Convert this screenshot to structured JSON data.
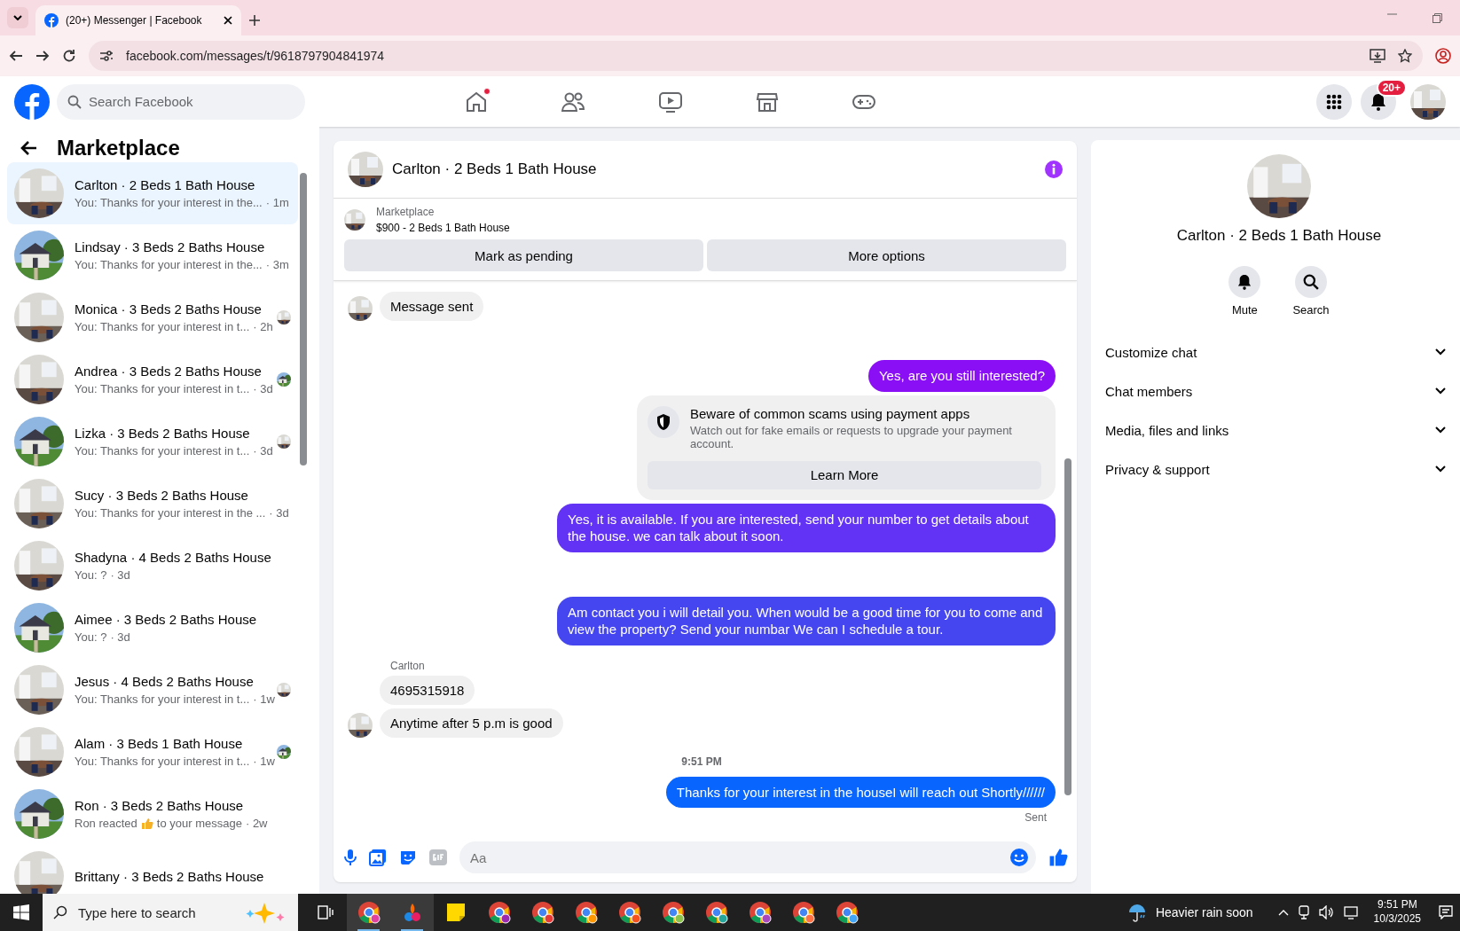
{
  "browser": {
    "tab_title": "(20+) Messenger | Facebook",
    "url": "facebook.com/messages/t/9618797904841974"
  },
  "topbar": {
    "search_placeholder": "Search Facebook",
    "notification_count": "20+",
    "home_dot": true
  },
  "sidebar": {
    "title": "Marketplace",
    "items": [
      {
        "name": "Carlton · 2 Beds 1 Bath House",
        "preview": "You: Thanks for your interest in the...",
        "time": " · 1m",
        "selected": true,
        "reader": false
      },
      {
        "name": "Lindsay · 3 Beds 2 Baths House",
        "preview": "You: Thanks for your interest in the...",
        "time": " · 3m",
        "selected": false,
        "reader": false
      },
      {
        "name": "Monica · 3 Beds 2 Baths House",
        "preview": "You: Thanks for your interest in t...",
        "time": " · 2h",
        "selected": false,
        "reader": true
      },
      {
        "name": "Andrea · 3 Beds 2 Baths House",
        "preview": "You: Thanks for your interest in t...",
        "time": " · 3d",
        "selected": false,
        "reader": true
      },
      {
        "name": "Lizka · 3 Beds 2 Baths House",
        "preview": "You: Thanks for your interest in t...",
        "time": " · 3d",
        "selected": false,
        "reader": true
      },
      {
        "name": "Sucy · 3 Beds 2 Baths House",
        "preview": "You: Thanks for your interest in the ...",
        "time": " · 3d",
        "selected": false,
        "reader": false
      },
      {
        "name": "Shadyna · 4 Beds 2 Baths House",
        "preview": "You: ?",
        "time": " · 3d",
        "selected": false,
        "reader": false
      },
      {
        "name": "Aimee · 3 Beds 2 Baths House",
        "preview": "You: ?",
        "time": " · 3d",
        "selected": false,
        "reader": false
      },
      {
        "name": "Jesus · 4 Beds 2 Baths House",
        "preview": "You: Thanks for your interest in t...",
        "time": " · 1w",
        "selected": false,
        "reader": true
      },
      {
        "name": "Alam · 3 Beds 1 Bath House",
        "preview": "You: Thanks for your interest in t...",
        "time": " · 1w",
        "selected": false,
        "reader": true
      },
      {
        "name": "Ron · 3 Beds 2 Baths House",
        "preview": "Ron reacted",
        "reaction": true,
        "preview_after": "to your message",
        "time": " · 2w",
        "selected": false,
        "reader": false
      },
      {
        "name": "Brittany · 3 Beds 2 Baths House",
        "selected": false,
        "reader": false
      }
    ]
  },
  "chat": {
    "title": "Carlton · 2 Beds 1 Bath House",
    "listing": {
      "label": "Marketplace",
      "price_title": "$900 - 2 Beds 1 Bath House"
    },
    "actions": [
      "Mark as pending",
      "More options"
    ],
    "messages": [
      {
        "kind": "incoming",
        "text": "Message sent",
        "avatar": true
      },
      {
        "kind": "outgoing",
        "text": "Yes, are you still interested?",
        "color": "#8a0ff5"
      },
      {
        "kind": "notice",
        "title": "Beware of common scams using payment apps",
        "text": "Watch out for fake emails or requests to upgrade your payment account.",
        "button": "Learn More"
      },
      {
        "kind": "outgoing",
        "text": "Yes, it is available. If you are interested, send your number to get details about the house. we can talk about it soon.",
        "color": "#6233f5"
      },
      {
        "kind": "outgoing",
        "text": "Am contact you i will detail you.  When would be a good time for you to come and view the property? Send your numbar We can I schedule a tour.",
        "color": "#4646f0"
      },
      {
        "kind": "sender",
        "text": "Carlton"
      },
      {
        "kind": "incoming",
        "text": "4695315918",
        "avatar": false
      },
      {
        "kind": "incoming",
        "text": "Anytime after 5 p.m is good",
        "avatar": true
      },
      {
        "kind": "time",
        "text": "9:51 PM"
      },
      {
        "kind": "outgoing",
        "text": "Thanks for your interest in the houseI will reach out Shortly//////",
        "color": "#0866ff"
      },
      {
        "kind": "status",
        "text": "Sent"
      }
    ],
    "composer": {
      "placeholder": "Aa"
    }
  },
  "details": {
    "title": "Carlton · 2 Beds 1 Bath House",
    "actions": [
      {
        "kind": "bell",
        "label": "Mute"
      },
      {
        "kind": "search",
        "label": "Search"
      }
    ],
    "sections": [
      {
        "label": "Customize chat",
        "expanded": false
      },
      {
        "label": "Chat members",
        "expanded": false
      },
      {
        "label": "Media, files and links",
        "expanded": false
      },
      {
        "label": "Privacy & support",
        "expanded": false
      }
    ]
  },
  "taskbar": {
    "search_placeholder": "Type here to search",
    "weather": "Heavier rain soon",
    "time": "9:51 PM",
    "date": "10/3/2025"
  }
}
